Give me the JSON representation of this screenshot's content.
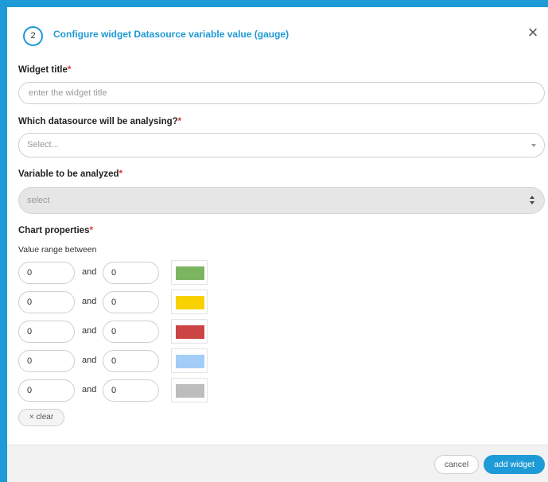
{
  "dialog": {
    "step_number": "2",
    "title": "Configure widget Datasource variable value (gauge)",
    "close_glyph": "×"
  },
  "widget_title": {
    "label": "Widget title",
    "required_mark": "*",
    "placeholder": "enter the widget title",
    "value": ""
  },
  "datasource": {
    "label": "Which datasource will be analysing?",
    "required_mark": "*",
    "selected": "Select..."
  },
  "variable": {
    "label": "Variable to be analyzed",
    "required_mark": "*",
    "selected": "select"
  },
  "chart_properties": {
    "label": "Chart properties",
    "required_mark": "*",
    "range_label": "Value range between",
    "and_text": "and",
    "ranges": [
      {
        "from": "0",
        "to": "0",
        "color": "#7cb561"
      },
      {
        "from": "0",
        "to": "0",
        "color": "#f7d100"
      },
      {
        "from": "0",
        "to": "0",
        "color": "#cc4444"
      },
      {
        "from": "0",
        "to": "0",
        "color": "#a3cdf7"
      },
      {
        "from": "0",
        "to": "0",
        "color": "#bdbdbd"
      }
    ],
    "clear_label": "clear",
    "clear_icon": "×"
  },
  "footer": {
    "cancel_label": "cancel",
    "add_label": "add widget"
  },
  "colors": {
    "accent": "#1e9ad6",
    "required": "#d9313a"
  }
}
